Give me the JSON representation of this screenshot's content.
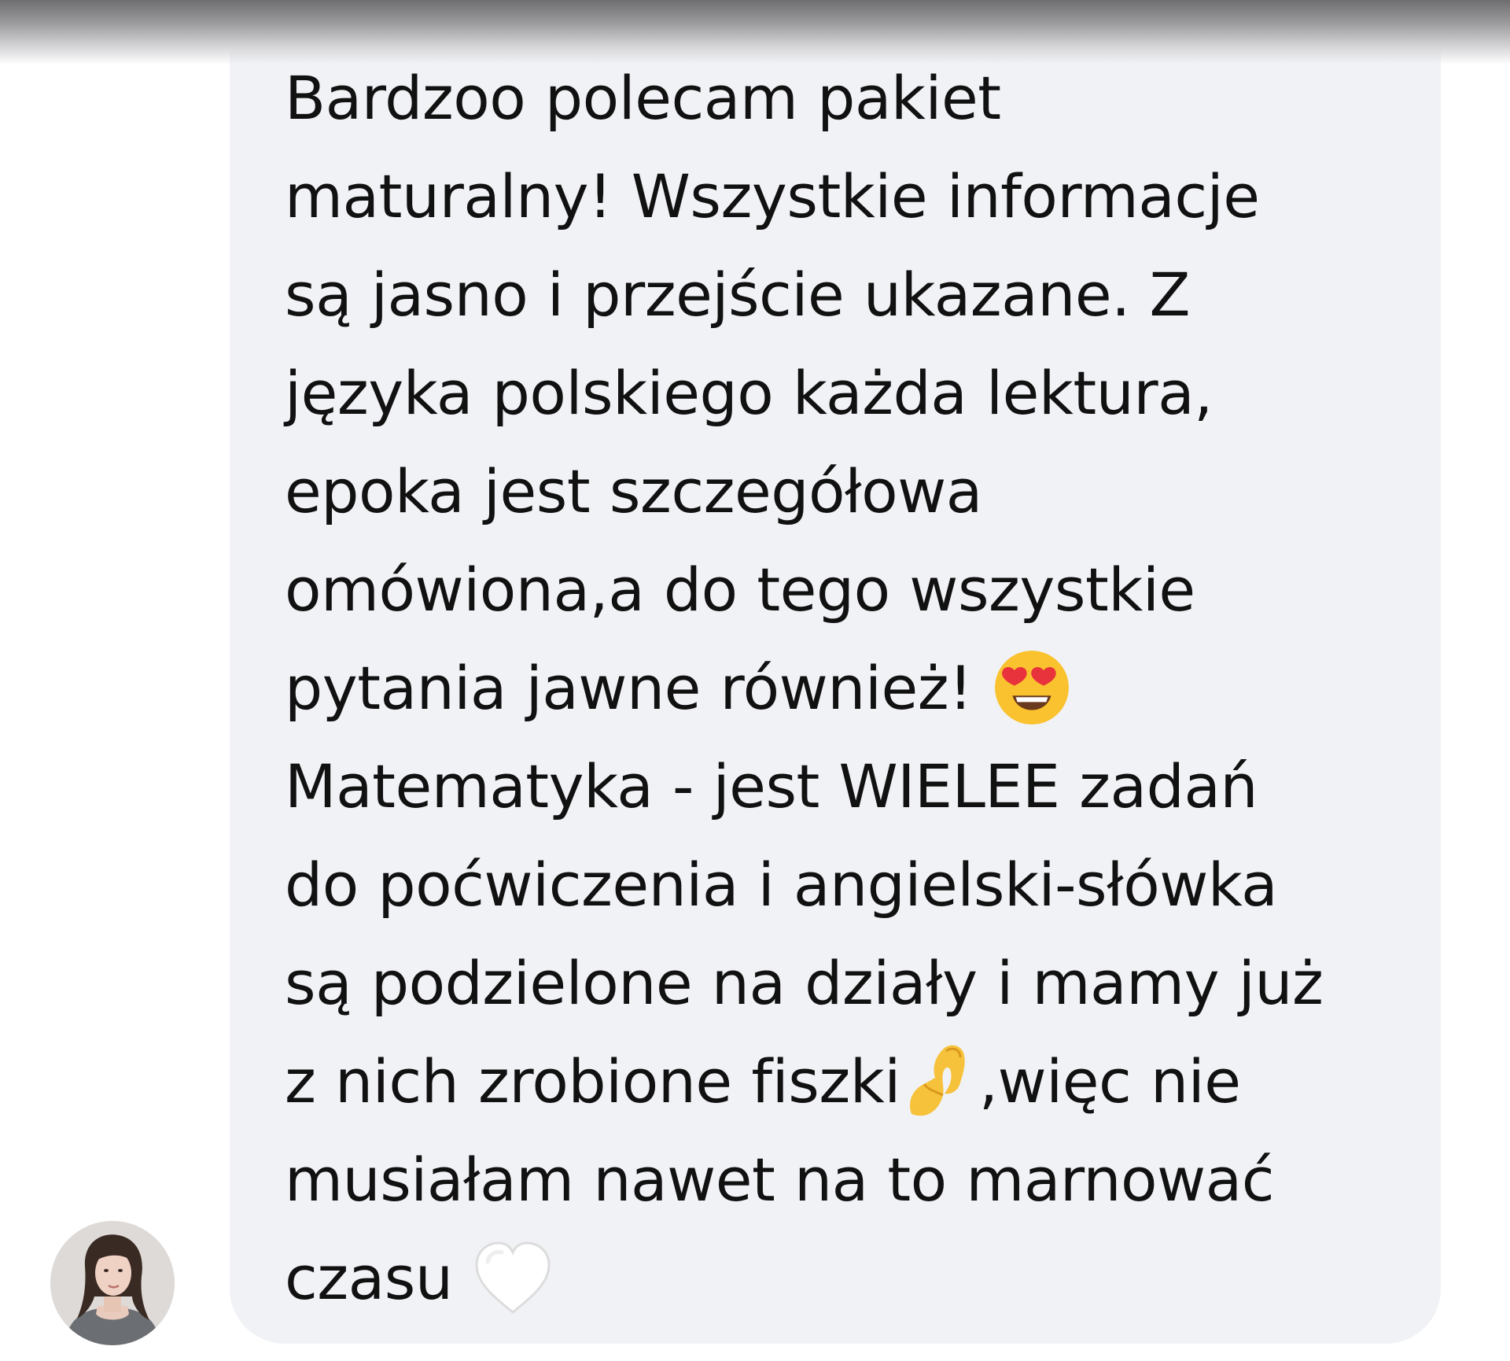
{
  "message": {
    "lines": [
      "Bardzoo polecam pakiet",
      "maturalny! Wszystkie informacje",
      "są jasno i przejście ukazane. Z",
      "języka polskiego każda lektura,",
      "epoka jest szczegółowa",
      "omówiona,a do tego wszystkie",
      "pytania jawne również! ",
      "Matematyka - jest WIELEE zadań",
      "do poćwiczenia i angielski-słówka",
      "są podzielone na działy i mamy już",
      "z nich zrobione fiszki",
      ",więc nie",
      "musiałam nawet na to marnować",
      "czasu "
    ]
  },
  "emojis": {
    "heart_eyes": "heart-eyes-emoji",
    "pinching_hand": "pinching-hand-emoji",
    "white_heart": "white-heart-emoji"
  },
  "colors": {
    "bubble": "#f1f2f6",
    "text": "#111111",
    "background": "#ffffff"
  }
}
